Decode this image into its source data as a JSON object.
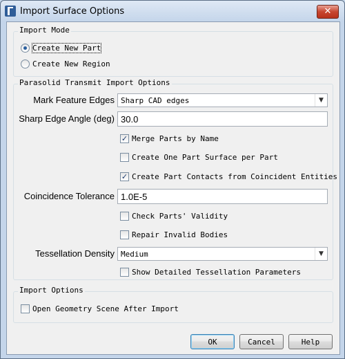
{
  "window": {
    "title": "Import Surface Options",
    "close_glyph": "✕",
    "icon": "app-icon"
  },
  "import_mode": {
    "label": "Import Mode",
    "options": [
      {
        "label": "Create New Part",
        "selected": true
      },
      {
        "label": "Create New Region",
        "selected": false
      }
    ]
  },
  "parasolid": {
    "label": "Parasolid Transmit Import Options",
    "mark_feature_edges": {
      "label": "Mark Feature Edges",
      "value": "Sharp CAD edges"
    },
    "sharp_edge_angle": {
      "label": "Sharp Edge Angle (deg)",
      "value": "30.0"
    },
    "merge_parts": {
      "label": "Merge Parts by Name",
      "checked": true
    },
    "one_surface_per_part": {
      "label": "Create One Part Surface per Part",
      "checked": false
    },
    "part_contacts": {
      "label": "Create Part Contacts from Coincident Entities",
      "checked": true
    },
    "coincidence_tolerance": {
      "label": "Coincidence Tolerance",
      "value": "1.0E-5"
    },
    "check_validity": {
      "label": "Check Parts' Validity",
      "checked": false
    },
    "repair_invalid": {
      "label": "Repair Invalid Bodies",
      "checked": false
    },
    "tessellation_density": {
      "label": "Tessellation Density",
      "value": "Medium"
    },
    "show_tessellation_params": {
      "label": "Show Detailed Tessellation Parameters",
      "checked": false
    }
  },
  "import_options": {
    "label": "Import Options",
    "open_geometry_scene": {
      "label": "Open Geometry Scene After Import",
      "checked": false
    }
  },
  "buttons": {
    "ok": "OK",
    "cancel": "Cancel",
    "help": "Help"
  },
  "check_glyph": "✓",
  "arrow_glyph": "▼"
}
